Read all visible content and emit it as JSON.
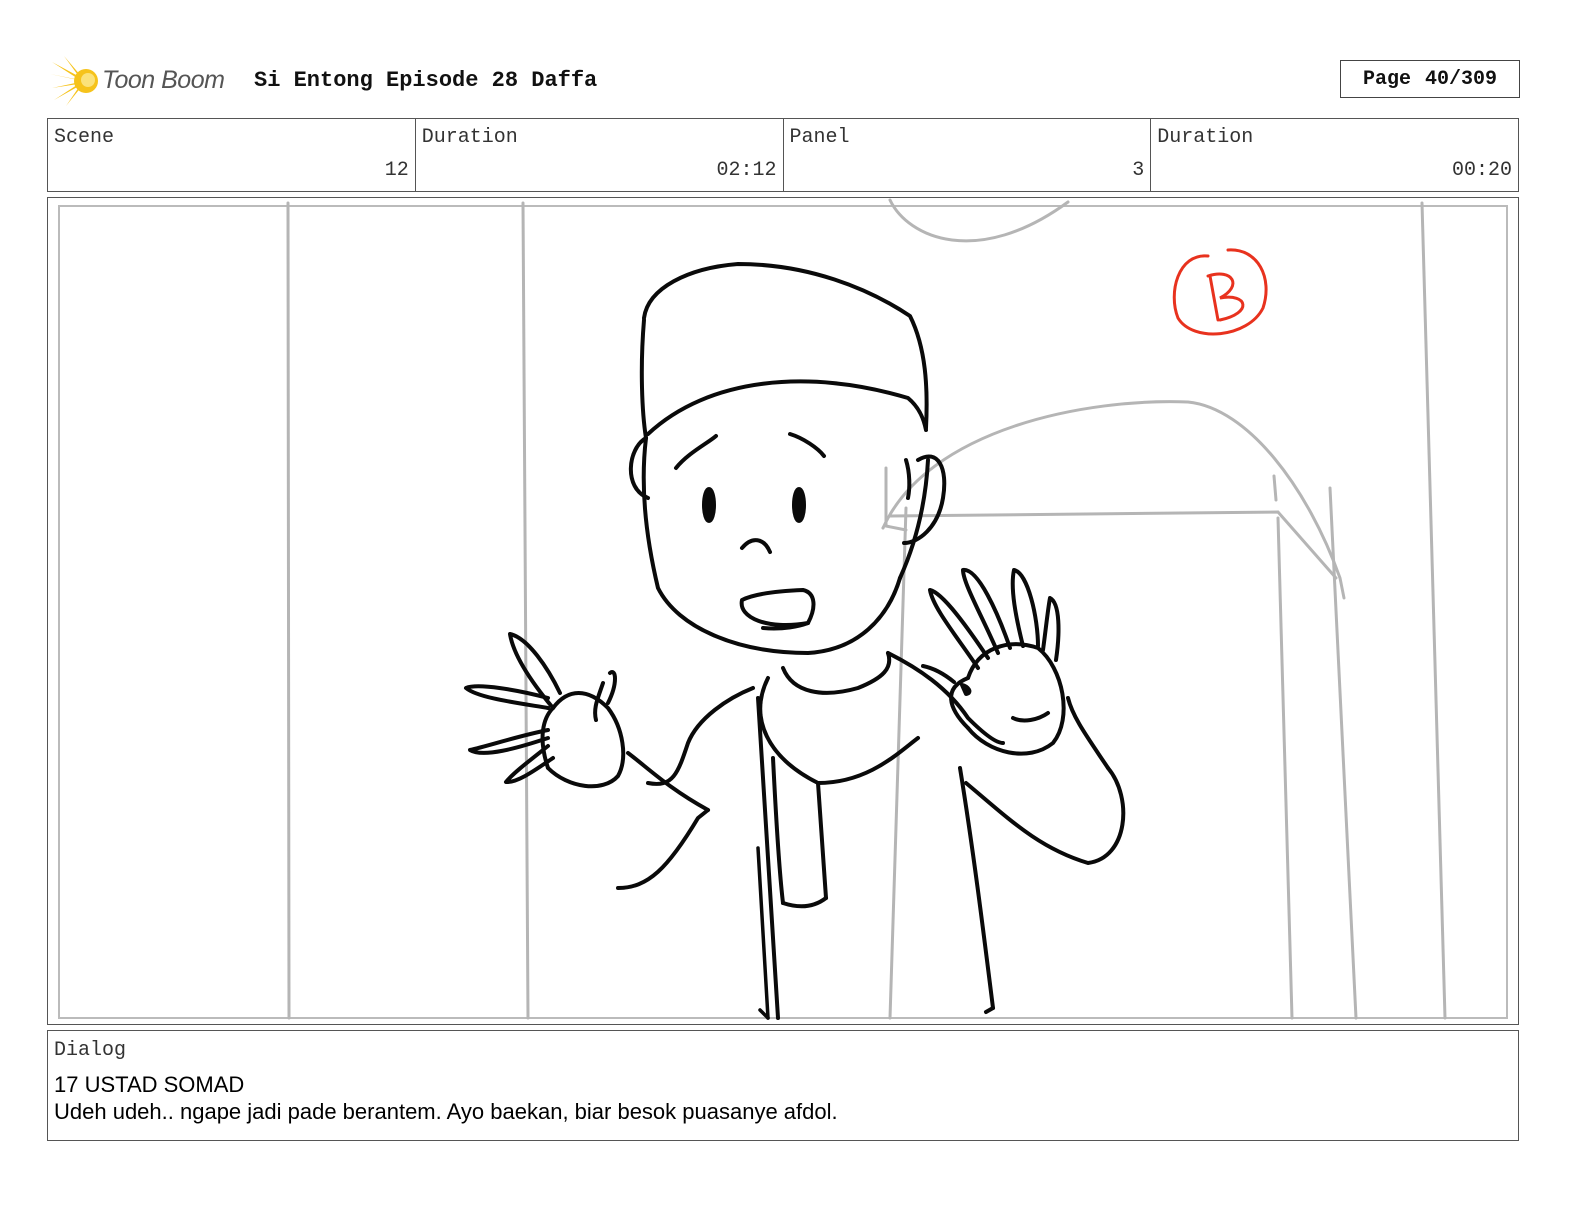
{
  "header": {
    "brand": "Toon Boom",
    "title": "Si Entong Episode 28 Daffa",
    "page_label": "Page",
    "page_value": "40/309"
  },
  "info": {
    "scene_label": "Scene",
    "scene_value": "12",
    "scene_duration_label": "Duration",
    "scene_duration_value": "02:12",
    "panel_label": "Panel",
    "panel_value": "3",
    "panel_duration_label": "Duration",
    "panel_duration_value": "00:20"
  },
  "panel": {
    "mark_letter": "B",
    "mark_color": "#e8321e"
  },
  "dialog": {
    "label": "Dialog",
    "speaker": "17 USTAD SOMAD",
    "line": "Udeh udeh.. ngape jadi pade berantem. Ayo baekan, biar besok puasanye afdol."
  }
}
